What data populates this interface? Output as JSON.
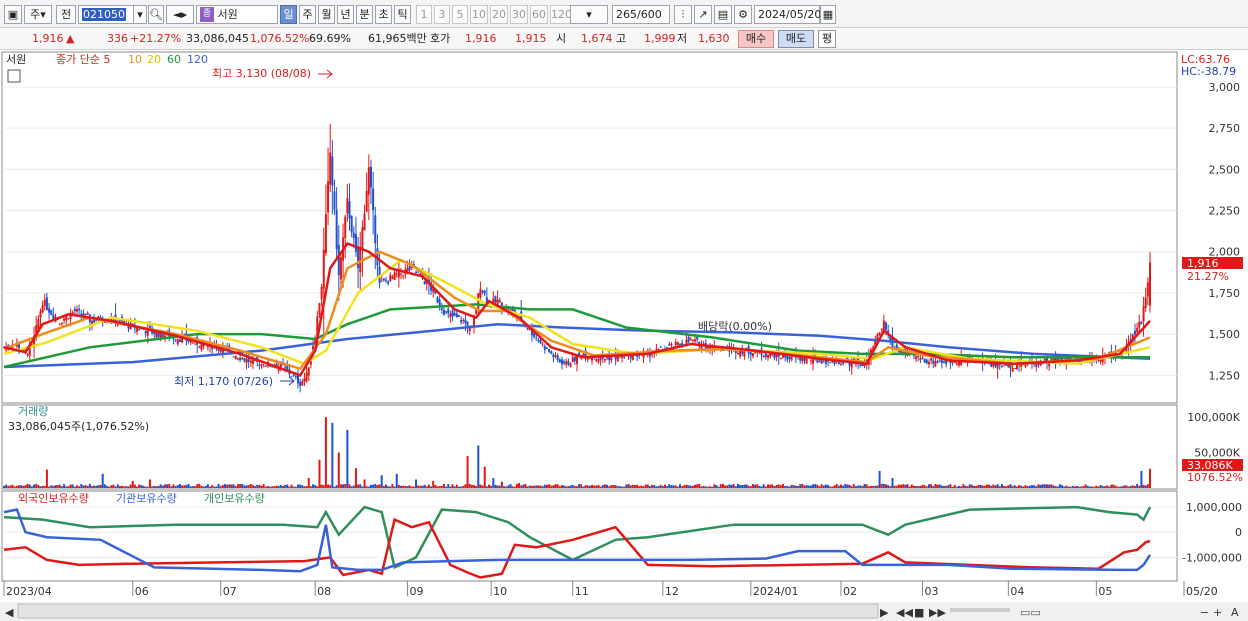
{
  "toolbar": {
    "period_type": "주",
    "all_label": "전",
    "stock_code": "021050",
    "stock_name": "서원",
    "stock_badge": "종",
    "periods": [
      "일",
      "주",
      "월",
      "년",
      "분",
      "초",
      "틱"
    ],
    "active_period": "일",
    "minutes": [
      "1",
      "3",
      "5",
      "10",
      "20",
      "30",
      "60",
      "120"
    ],
    "count": "265",
    "count_total": "/600",
    "date": "2024/05/20"
  },
  "quote": {
    "price": "1,916",
    "arrow": "▲",
    "change": "336",
    "change_pct": "+21.27%",
    "volume": "33,086,045",
    "volume_pct": "1,076.52%",
    "turnover": "69.69%",
    "amount": "61,965백만",
    "bid_label": "호가",
    "bid_price": "1,916",
    "ask_price": "1,915",
    "open_label": "시",
    "open": "1,674",
    "high_label": "고",
    "high": "1,999",
    "low_label": "저",
    "low": "1,630",
    "buy_label": "매수",
    "sell_label": "매도",
    "avg_label": "평"
  },
  "legend": {
    "stock": "서원",
    "ma_label": "종가 단순 5",
    "ma_periods": [
      "10",
      "20",
      "60",
      "120"
    ]
  },
  "colors": {
    "up": "#e01818",
    "down": "#1f50d0",
    "ma5": "#e01818",
    "ma10": "#f08c1e",
    "ma20": "#f0e21e",
    "ma60": "#1f9a3a",
    "ma120": "#3a62d8",
    "foreign": "#e01818",
    "institution": "#3a62d8",
    "individual": "#2f8f5a"
  },
  "annotations": {
    "high": "최고 3,130 (08/08)",
    "low": "최저 1,170 (07/26)",
    "dividend": "배당락(0.00%)",
    "lc": "LC:63.76",
    "hc": "HC:-38.79"
  },
  "volume_panel": {
    "title": "거래량",
    "value": "33,086,045주(1,076.52%)",
    "last_label": "33,086K",
    "last_pct": "1076.52%"
  },
  "holding_panel": {
    "series": [
      "외국인보유수량",
      "기관보유수량",
      "개인보유수량"
    ]
  },
  "chart_data": {
    "type": "candlestick",
    "title": "",
    "price_axis": {
      "ticks": [
        1250,
        1500,
        1750,
        2000,
        2250,
        2500,
        2750,
        3000
      ],
      "range": [
        1100,
        3200
      ]
    },
    "last_price_label": "1,916",
    "last_change_label": "21.27%",
    "volume_axis": {
      "ticks": [
        50000,
        100000
      ],
      "tick_labels": [
        "50,000K",
        "100,000K"
      ]
    },
    "holding_axis": {
      "ticks": [
        -1000000,
        0,
        1000000
      ],
      "tick_labels": [
        "-1,000,000",
        "0",
        "1,000,000"
      ]
    },
    "x_labels": [
      "2023/04",
      "06",
      "07",
      "08",
      "09",
      "10",
      "11",
      "12",
      "2024/01",
      "02",
      "03",
      "04",
      "05",
      "05/20"
    ],
    "price_series": [
      [
        0,
        1420
      ],
      [
        6,
        1440
      ],
      [
        10,
        1380
      ],
      [
        13,
        1420
      ],
      [
        18,
        1700
      ],
      [
        22,
        1630
      ],
      [
        26,
        1580
      ],
      [
        33,
        1640
      ],
      [
        41,
        1580
      ],
      [
        48,
        1600
      ],
      [
        56,
        1560
      ],
      [
        67,
        1520
      ],
      [
        80,
        1480
      ],
      [
        92,
        1440
      ],
      [
        100,
        1420
      ],
      [
        115,
        1330
      ],
      [
        130,
        1300
      ],
      [
        138,
        1200
      ],
      [
        141,
        1250
      ],
      [
        145,
        1500
      ],
      [
        148,
        1800
      ],
      [
        152,
        2600
      ],
      [
        156,
        1850
      ],
      [
        160,
        2300
      ],
      [
        165,
        1900
      ],
      [
        170,
        2500
      ],
      [
        175,
        1800
      ],
      [
        182,
        1850
      ],
      [
        190,
        1900
      ],
      [
        198,
        1800
      ],
      [
        206,
        1620
      ],
      [
        214,
        1580
      ],
      [
        218,
        1520
      ],
      [
        222,
        1800
      ],
      [
        226,
        1680
      ],
      [
        230,
        1700
      ],
      [
        240,
        1600
      ],
      [
        252,
        1420
      ],
      [
        258,
        1340
      ],
      [
        262,
        1320
      ],
      [
        270,
        1380
      ],
      [
        278,
        1350
      ],
      [
        290,
        1370
      ],
      [
        300,
        1380
      ],
      [
        310,
        1420
      ],
      [
        320,
        1460
      ],
      [
        330,
        1420
      ],
      [
        345,
        1400
      ],
      [
        355,
        1380
      ],
      [
        365,
        1360
      ],
      [
        380,
        1340
      ],
      [
        392,
        1330
      ],
      [
        402,
        1320
      ],
      [
        406,
        1450
      ],
      [
        410,
        1570
      ],
      [
        414,
        1420
      ],
      [
        420,
        1380
      ],
      [
        430,
        1340
      ],
      [
        440,
        1330
      ],
      [
        450,
        1360
      ],
      [
        460,
        1320
      ],
      [
        470,
        1310
      ],
      [
        480,
        1330
      ],
      [
        490,
        1340
      ],
      [
        500,
        1350
      ],
      [
        512,
        1360
      ],
      [
        518,
        1380
      ],
      [
        522,
        1400
      ],
      [
        526,
        1480
      ],
      [
        530,
        1580
      ],
      [
        534,
        1916
      ]
    ],
    "ma5": [
      [
        0,
        1420
      ],
      [
        10,
        1390
      ],
      [
        18,
        1560
      ],
      [
        30,
        1620
      ],
      [
        50,
        1580
      ],
      [
        80,
        1490
      ],
      [
        110,
        1380
      ],
      [
        138,
        1250
      ],
      [
        145,
        1400
      ],
      [
        152,
        1900
      ],
      [
        160,
        2050
      ],
      [
        170,
        2000
      ],
      [
        180,
        1900
      ],
      [
        195,
        1850
      ],
      [
        210,
        1650
      ],
      [
        220,
        1600
      ],
      [
        226,
        1700
      ],
      [
        240,
        1600
      ],
      [
        255,
        1420
      ],
      [
        270,
        1360
      ],
      [
        300,
        1380
      ],
      [
        320,
        1440
      ],
      [
        350,
        1400
      ],
      [
        380,
        1350
      ],
      [
        402,
        1320
      ],
      [
        410,
        1520
      ],
      [
        420,
        1420
      ],
      [
        440,
        1340
      ],
      [
        470,
        1320
      ],
      [
        500,
        1340
      ],
      [
        520,
        1380
      ],
      [
        534,
        1580
      ]
    ],
    "ma10": [
      [
        0,
        1410
      ],
      [
        18,
        1500
      ],
      [
        40,
        1600
      ],
      [
        80,
        1500
      ],
      [
        110,
        1400
      ],
      [
        138,
        1290
      ],
      [
        150,
        1500
      ],
      [
        160,
        1900
      ],
      [
        175,
        2000
      ],
      [
        190,
        1920
      ],
      [
        210,
        1720
      ],
      [
        222,
        1640
      ],
      [
        234,
        1640
      ],
      [
        255,
        1460
      ],
      [
        275,
        1370
      ],
      [
        310,
        1400
      ],
      [
        340,
        1410
      ],
      [
        380,
        1360
      ],
      [
        402,
        1330
      ],
      [
        412,
        1420
      ],
      [
        430,
        1370
      ],
      [
        470,
        1320
      ],
      [
        510,
        1350
      ],
      [
        534,
        1480
      ]
    ],
    "ma20": [
      [
        0,
        1380
      ],
      [
        20,
        1450
      ],
      [
        50,
        1600
      ],
      [
        90,
        1520
      ],
      [
        120,
        1420
      ],
      [
        140,
        1320
      ],
      [
        150,
        1400
      ],
      [
        165,
        1750
      ],
      [
        185,
        1950
      ],
      [
        205,
        1820
      ],
      [
        225,
        1680
      ],
      [
        245,
        1600
      ],
      [
        265,
        1440
      ],
      [
        295,
        1380
      ],
      [
        335,
        1410
      ],
      [
        380,
        1380
      ],
      [
        405,
        1350
      ],
      [
        420,
        1420
      ],
      [
        450,
        1350
      ],
      [
        500,
        1320
      ],
      [
        534,
        1420
      ]
    ],
    "ma60": [
      [
        0,
        1300
      ],
      [
        40,
        1420
      ],
      [
        90,
        1500
      ],
      [
        120,
        1500
      ],
      [
        145,
        1470
      ],
      [
        160,
        1560
      ],
      [
        180,
        1650
      ],
      [
        220,
        1680
      ],
      [
        245,
        1650
      ],
      [
        265,
        1650
      ],
      [
        290,
        1540
      ],
      [
        330,
        1480
      ],
      [
        370,
        1400
      ],
      [
        400,
        1380
      ],
      [
        430,
        1380
      ],
      [
        470,
        1360
      ],
      [
        534,
        1360
      ]
    ],
    "ma120": [
      [
        0,
        1300
      ],
      [
        60,
        1330
      ],
      [
        120,
        1400
      ],
      [
        160,
        1470
      ],
      [
        200,
        1520
      ],
      [
        230,
        1560
      ],
      [
        260,
        1540
      ],
      [
        300,
        1520
      ],
      [
        340,
        1510
      ],
      [
        380,
        1490
      ],
      [
        410,
        1460
      ],
      [
        440,
        1420
      ],
      [
        480,
        1380
      ],
      [
        534,
        1350
      ]
    ],
    "volume_series": [
      [
        20,
        26000
      ],
      [
        46,
        20000
      ],
      [
        60,
        10000
      ],
      [
        68,
        12000
      ],
      [
        142,
        14000
      ],
      [
        147,
        40000
      ],
      [
        150,
        100000
      ],
      [
        153,
        92000
      ],
      [
        156,
        50000
      ],
      [
        160,
        82000
      ],
      [
        164,
        28000
      ],
      [
        168,
        12000
      ],
      [
        176,
        18000
      ],
      [
        183,
        20000
      ],
      [
        192,
        12000
      ],
      [
        200,
        10000
      ],
      [
        216,
        45000
      ],
      [
        221,
        60000
      ],
      [
        224,
        30000
      ],
      [
        228,
        14000
      ],
      [
        232,
        9000
      ],
      [
        240,
        7000
      ],
      [
        300,
        5000
      ],
      [
        408,
        24000
      ],
      [
        414,
        14000
      ],
      [
        530,
        24000
      ],
      [
        534,
        27000
      ]
    ],
    "foreign_series": [
      [
        0,
        -700000
      ],
      [
        10,
        -600000
      ],
      [
        20,
        -1100000
      ],
      [
        35,
        -1300000
      ],
      [
        60,
        -1250000
      ],
      [
        100,
        -1200000
      ],
      [
        140,
        -1150000
      ],
      [
        152,
        -1000000
      ],
      [
        158,
        -1700000
      ],
      [
        170,
        -1500000
      ],
      [
        176,
        -1650000
      ],
      [
        182,
        500000
      ],
      [
        190,
        200000
      ],
      [
        198,
        400000
      ],
      [
        208,
        -1300000
      ],
      [
        216,
        -1600000
      ],
      [
        222,
        -1800000
      ],
      [
        232,
        -1650000
      ],
      [
        238,
        -500000
      ],
      [
        248,
        -600000
      ],
      [
        265,
        -300000
      ],
      [
        285,
        200000
      ],
      [
        300,
        -1300000
      ],
      [
        330,
        -1350000
      ],
      [
        370,
        -1300000
      ],
      [
        400,
        -1250000
      ],
      [
        412,
        -800000
      ],
      [
        420,
        -1200000
      ],
      [
        450,
        -1300000
      ],
      [
        480,
        -1400000
      ],
      [
        510,
        -1450000
      ],
      [
        522,
        -800000
      ],
      [
        528,
        -700000
      ],
      [
        532,
        -400000
      ],
      [
        534,
        -350000
      ]
    ],
    "institution_series": [
      [
        0,
        800000
      ],
      [
        6,
        900000
      ],
      [
        10,
        0
      ],
      [
        20,
        -200000
      ],
      [
        45,
        -300000
      ],
      [
        70,
        -1400000
      ],
      [
        120,
        -1500000
      ],
      [
        138,
        -1550000
      ],
      [
        146,
        -1300000
      ],
      [
        150,
        300000
      ],
      [
        153,
        -1400000
      ],
      [
        165,
        -1500000
      ],
      [
        176,
        -1500000
      ],
      [
        186,
        -1200000
      ],
      [
        230,
        -1100000
      ],
      [
        265,
        -1100000
      ],
      [
        320,
        -1100000
      ],
      [
        355,
        -1050000
      ],
      [
        370,
        -750000
      ],
      [
        392,
        -750000
      ],
      [
        400,
        -1300000
      ],
      [
        440,
        -1300000
      ],
      [
        470,
        -1450000
      ],
      [
        520,
        -1500000
      ],
      [
        528,
        -1500000
      ],
      [
        531,
        -1300000
      ],
      [
        534,
        -900000
      ]
    ],
    "individual_series": [
      [
        0,
        600000
      ],
      [
        18,
        500000
      ],
      [
        40,
        200000
      ],
      [
        80,
        300000
      ],
      [
        130,
        300000
      ],
      [
        146,
        200000
      ],
      [
        150,
        800000
      ],
      [
        156,
        -100000
      ],
      [
        168,
        1000000
      ],
      [
        176,
        800000
      ],
      [
        182,
        -1400000
      ],
      [
        192,
        -1000000
      ],
      [
        204,
        900000
      ],
      [
        220,
        800000
      ],
      [
        235,
        400000
      ],
      [
        245,
        -200000
      ],
      [
        265,
        -1100000
      ],
      [
        285,
        -300000
      ],
      [
        300,
        -200000
      ],
      [
        340,
        300000
      ],
      [
        400,
        300000
      ],
      [
        412,
        -100000
      ],
      [
        420,
        300000
      ],
      [
        450,
        900000
      ],
      [
        500,
        1000000
      ],
      [
        515,
        800000
      ],
      [
        528,
        700000
      ],
      [
        531,
        500000
      ],
      [
        534,
        1000000
      ]
    ]
  }
}
